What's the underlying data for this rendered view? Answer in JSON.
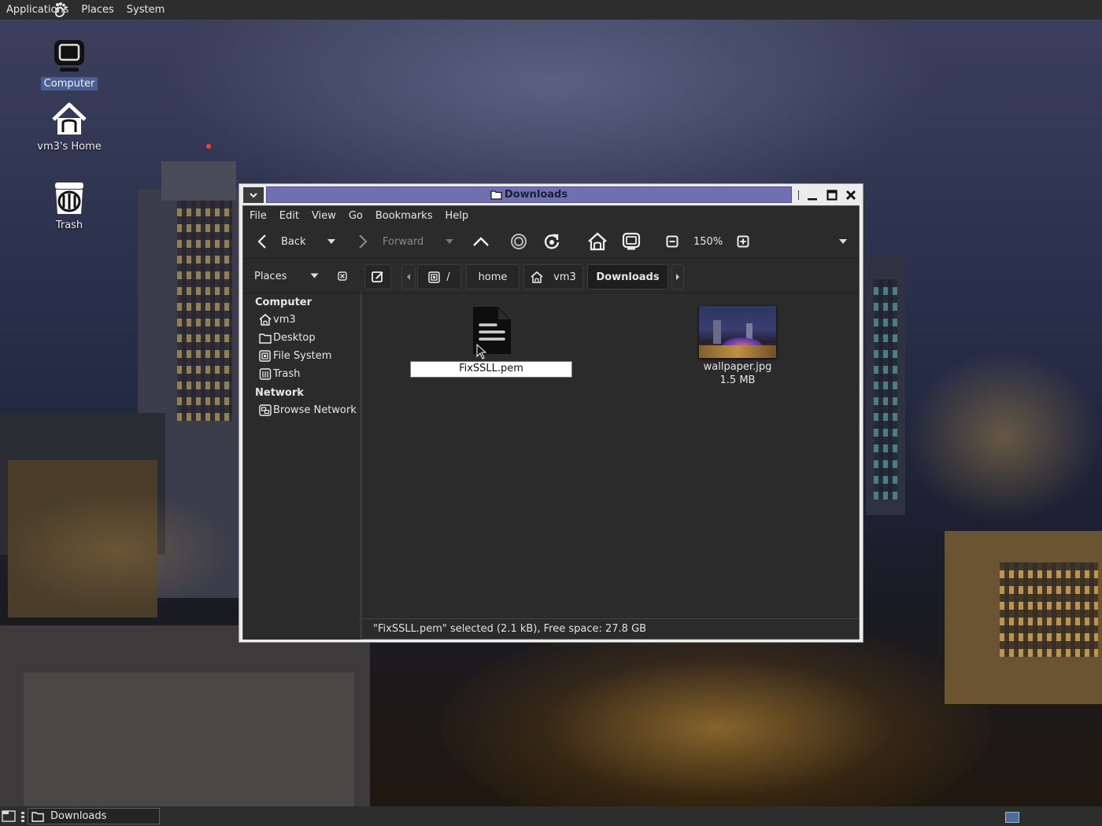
{
  "top_panel": {
    "menus": [
      "Applications",
      "Places",
      "System"
    ]
  },
  "desktop": {
    "icons": [
      {
        "label": "Computer",
        "icon": "computer-icon",
        "selected": true
      },
      {
        "label": "vm3's Home",
        "icon": "home-icon",
        "selected": false
      },
      {
        "label": "Trash",
        "icon": "trash-icon",
        "selected": false
      }
    ]
  },
  "window": {
    "title": "Downloads",
    "menubar": [
      "File",
      "Edit",
      "View",
      "Go",
      "Bookmarks",
      "Help"
    ],
    "toolbar": {
      "back_label": "Back",
      "forward_label": "Forward",
      "zoom_level": "150%"
    },
    "location": {
      "places_label": "Places",
      "root_label": "/",
      "crumbs": [
        "home",
        "vm3",
        "Downloads"
      ]
    },
    "sidebar": {
      "computer_header": "Computer",
      "computer_items": [
        "vm3",
        "Desktop",
        "File System",
        "Trash"
      ],
      "network_header": "Network",
      "network_items": [
        "Browse Network"
      ]
    },
    "files": [
      {
        "name": "FixSSLL.pem",
        "icon": "text-document-icon",
        "selected": true,
        "renaming": true
      },
      {
        "name": "wallpaper.jpg",
        "size": "1.5 MB",
        "icon": "image-thumbnail",
        "selected": false
      }
    ],
    "status": "\"FixSSLL.pem\" selected (2.1 kB), Free space: 27.8 GB"
  },
  "bottom_panel": {
    "task_label": "Downloads"
  },
  "colors": {
    "title_active": "#6f6fb1",
    "panel_bg": "#2d2d2d",
    "window_bg": "#2b2b2b",
    "desktop_selection": "#4a5f93"
  }
}
